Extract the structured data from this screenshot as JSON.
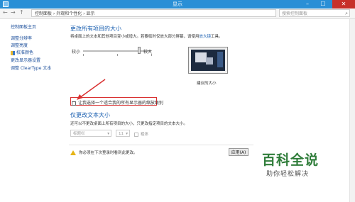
{
  "window": {
    "title": "显示",
    "controls": [
      "–",
      "☐",
      "✕"
    ]
  },
  "addressbar": {
    "back": "←",
    "forward": "→",
    "up": "↑",
    "path": "控制面板 › 外观和个性化 › 显示",
    "search_placeholder": "搜索控制面板"
  },
  "sidebar": {
    "items": [
      {
        "label": "控制面板主页"
      },
      {
        "label": "调整分辨率"
      },
      {
        "label": "调整亮度"
      },
      {
        "label": "校准颜色"
      },
      {
        "label": "更改显示器设置"
      },
      {
        "label": "调整 ClearType 文本"
      }
    ]
  },
  "main": {
    "heading": "更改所有项目的大小",
    "description": "将桌面上的文本和其他项目变小或增大。若要临时仅放大部分屏幕，请使用",
    "description_link": "放大镜",
    "description_tail": "工具。",
    "slider_min_label": "较小",
    "slider_max_label": "较大",
    "slider_value": 0.8,
    "preview_label": "建议的大小",
    "checkbox_label": "让我选择一个适合我的所有显示器的缩放级别",
    "checkbox_checked": false,
    "text_heading": "仅更改文本大小",
    "text_description": "还可以不更改桌面上所有项目的大小，只更改指定项目的文本大小。",
    "item_select": "标题栏",
    "size_select": "11",
    "bold_label": "粗体",
    "warning": "你必须在下次登录时看到此更改。",
    "apply_label": "应用(A)"
  },
  "watermark": {
    "title": "百科全说",
    "subtitle": "助你轻松解决"
  },
  "colors": {
    "titlebar": "#2a8fd6",
    "link": "#1a5fb0",
    "highlight": "#d93030"
  }
}
